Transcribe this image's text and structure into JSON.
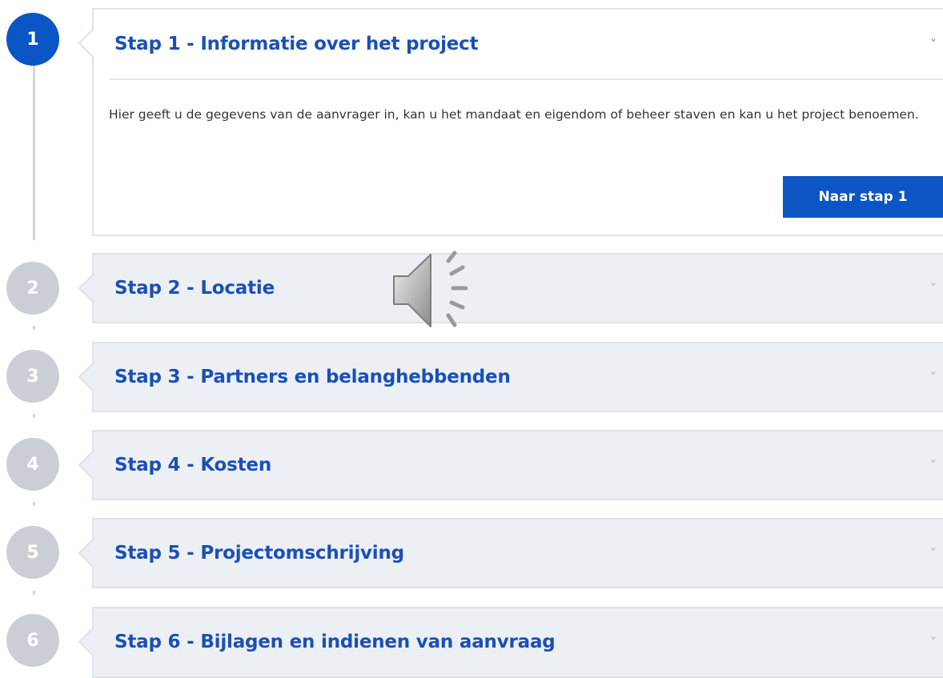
{
  "steps": [
    {
      "number": "1",
      "title": "Stap 1 - Informatie over het project",
      "description": "Hier geeft u de gegevens van de aanvrager in, kan u het mandaat en eigendom of beheer staven en kan u het project benoemen.",
      "button_label": "Naar stap 1",
      "chevron": "˅",
      "state": "expanded"
    },
    {
      "number": "2",
      "title": "Stap 2 - Locatie",
      "chevron": "˅",
      "state": "collapsed"
    },
    {
      "number": "3",
      "title": "Stap 3 - Partners en belanghebbenden",
      "chevron": "˅",
      "state": "collapsed"
    },
    {
      "number": "4",
      "title": "Stap 4 - Kosten",
      "chevron": "˅",
      "state": "collapsed"
    },
    {
      "number": "5",
      "title": "Stap 5 - Projectomschrijving",
      "chevron": "˅",
      "state": "collapsed"
    },
    {
      "number": "6",
      "title": "Stap 6 - Bijlagen en indienen van aanvraag",
      "chevron": "˅",
      "state": "collapsed"
    }
  ],
  "colors": {
    "accent": "#0b55c4",
    "title_text": "#1a4fb5",
    "inactive_circle": "#cbcfd5",
    "collapsed_panel": "#ecf0f5"
  },
  "overlay_icon": "speaker-audio-icon"
}
